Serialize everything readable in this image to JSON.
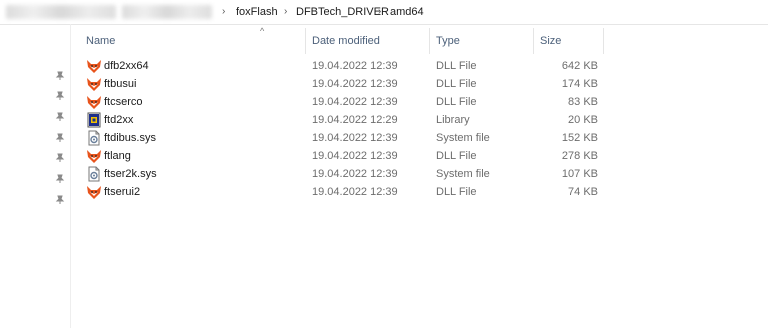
{
  "breadcrumb": {
    "items": [
      "foxFlash",
      "DFBTech_DRIVER",
      "amd64"
    ],
    "separator": "›"
  },
  "columns": {
    "name": "Name",
    "date_modified": "Date modified",
    "type": "Type",
    "size": "Size"
  },
  "files": [
    {
      "name": "dfb2xx64",
      "date": "19.04.2022 12:39",
      "type": "DLL File",
      "size": "642 KB",
      "icon": "fox-dll-icon"
    },
    {
      "name": "ftbusui",
      "date": "19.04.2022 12:39",
      "type": "DLL File",
      "size": "174 KB",
      "icon": "fox-dll-icon"
    },
    {
      "name": "ftcserco",
      "date": "19.04.2022 12:39",
      "type": "DLL File",
      "size": "83 KB",
      "icon": "fox-dll-icon"
    },
    {
      "name": "ftd2xx",
      "date": "19.04.2022 12:29",
      "type": "Library",
      "size": "20 KB",
      "icon": "library-icon"
    },
    {
      "name": "ftdibus.sys",
      "date": "19.04.2022 12:39",
      "type": "System file",
      "size": "152 KB",
      "icon": "system-file-icon"
    },
    {
      "name": "ftlang",
      "date": "19.04.2022 12:39",
      "type": "DLL File",
      "size": "278 KB",
      "icon": "fox-dll-icon"
    },
    {
      "name": "ftser2k.sys",
      "date": "19.04.2022 12:39",
      "type": "System file",
      "size": "107 KB",
      "icon": "system-file-icon"
    },
    {
      "name": "ftserui2",
      "date": "19.04.2022 12:39",
      "type": "DLL File",
      "size": "74 KB",
      "icon": "fox-dll-icon"
    }
  ],
  "colors": {
    "header_text": "#4c607a",
    "fox_orange": "#e8541c",
    "library_blue": "#1e2f8a"
  }
}
